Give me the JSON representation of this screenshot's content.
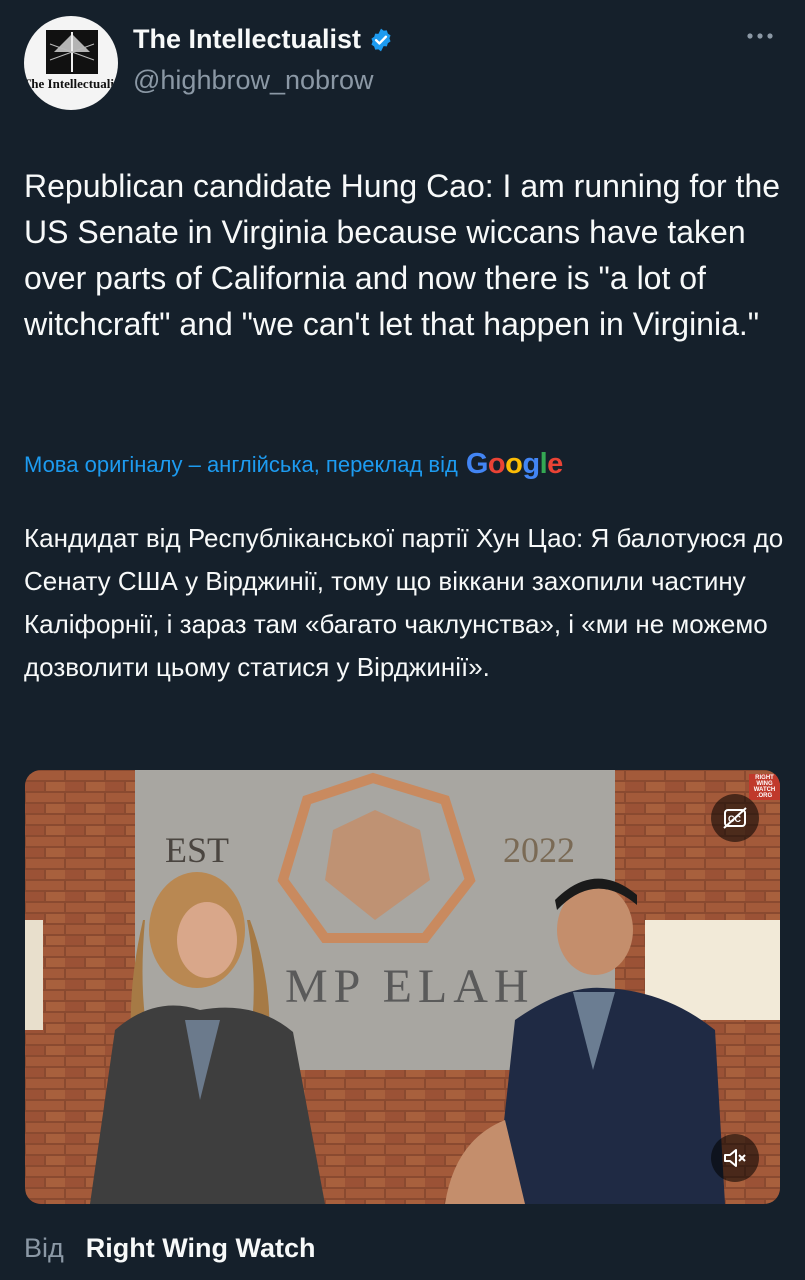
{
  "author": {
    "display_name": "The Intellectualist",
    "handle": "@highbrow_nobrow",
    "avatar_text": "The Intellectualist",
    "verified": true
  },
  "tweet": {
    "text": "Republican candidate Hung Cao: I am running for the US Senate in Virginia because wiccans have taken over parts of California and now there is \"a lot of witchcraft\" and \"we can't let that happen in Virginia.\"",
    "translate_note": "Мова оригіналу – англійська, переклад від",
    "translate_provider": "Google",
    "translation": "Кандидат від Республіканської партії Хун Цао: Я балотуюся до Сенату США у Вірджинії, тому що віккани захопили частину Каліфорнії, і зараз там «багато чаклунства», і «ми не можемо дозволити цьому статися у Вірджинії»."
  },
  "media": {
    "sign_left": "EST",
    "sign_right": "2022",
    "sign_bottom": "MP ELAH",
    "watermark": "RIGHT WING WATCH .ORG",
    "captions_icon": "closed-captions-icon",
    "mute_icon": "muted-speaker-icon"
  },
  "source": {
    "label": "Від",
    "name": "Right Wing Watch"
  },
  "colors": {
    "background": "#15202b",
    "text": "#f7f9f9",
    "secondary": "#8b98a5",
    "link": "#1d9bf0",
    "verified": "#1d9bf0"
  }
}
